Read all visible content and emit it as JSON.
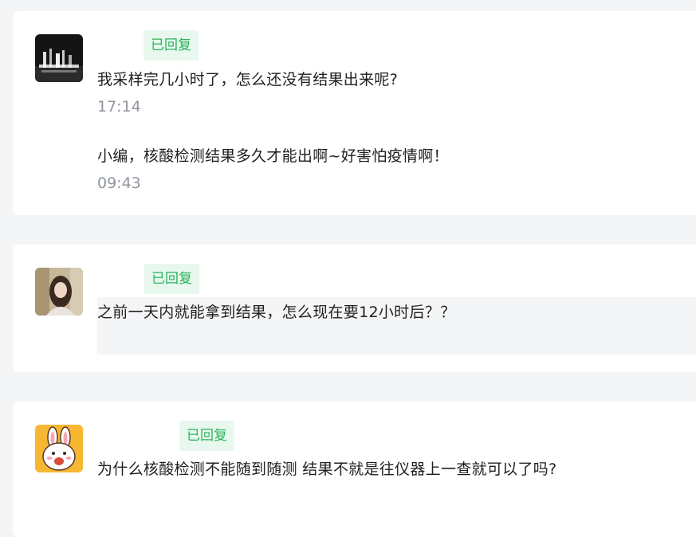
{
  "cards": [
    {
      "badge": "已回复",
      "messages": [
        {
          "text": "我采样完几小时了，怎么还没有结果出来呢?",
          "time": "17:14"
        },
        {
          "text": "小编，核酸检测结果多久才能出啊~好害怕疫情啊！",
          "time": "09:43"
        }
      ]
    },
    {
      "badge": "已回复",
      "messages": [
        {
          "text": "之前一天内就能拿到结果，怎么现在要12小时后？？"
        }
      ]
    },
    {
      "badge": "已回复",
      "messages": [
        {
          "text": "为什么核酸检测不能随到随测 结果不就是往仪器上一查就可以了吗?"
        }
      ]
    }
  ],
  "colors": {
    "page_bg": "#f4f5f7",
    "card_bg": "#ffffff",
    "badge_bg": "#e9f8ef",
    "badge_text": "#27b35a",
    "time_text": "#8f959e"
  },
  "icons": [
    "night-building-avatar-icon",
    "woman-portrait-avatar-icon",
    "cartoon-rabbit-avatar-icon"
  ]
}
